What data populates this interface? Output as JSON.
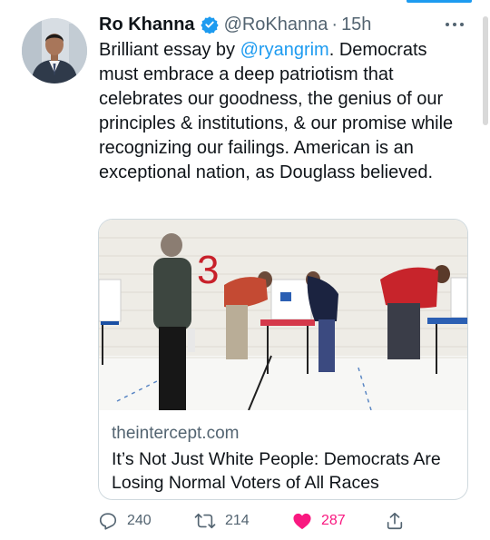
{
  "tweet": {
    "author_name": "Ro Khanna",
    "handle": "@RoKhanna",
    "separator": "·",
    "timestamp": "15h",
    "text_before": "Brilliant essay by ",
    "mention": "@ryangrim",
    "text_after": ". Democrats must embrace a deep patriotism that celebrates our goodness, the genius of our principles & institutions, & our promise while recognizing our failings. American is an exceptional nation, as Douglass believed."
  },
  "card": {
    "domain": "theintercept.com",
    "title": "It’s Not Just White People: Democrats Are Losing Normal Voters of All Races",
    "photo_number": "3"
  },
  "actions": {
    "replies": "240",
    "retweets": "214",
    "likes": "287"
  },
  "icons": {
    "verified": "verified-badge-icon",
    "more": "more-horizontal-icon",
    "reply": "reply-icon",
    "retweet": "retweet-icon",
    "like": "heart-filled-icon",
    "share": "share-icon"
  },
  "colors": {
    "accent": "#1d9bf0",
    "like": "#f91880",
    "secondary_text": "#536471",
    "border": "#cfd9de"
  }
}
